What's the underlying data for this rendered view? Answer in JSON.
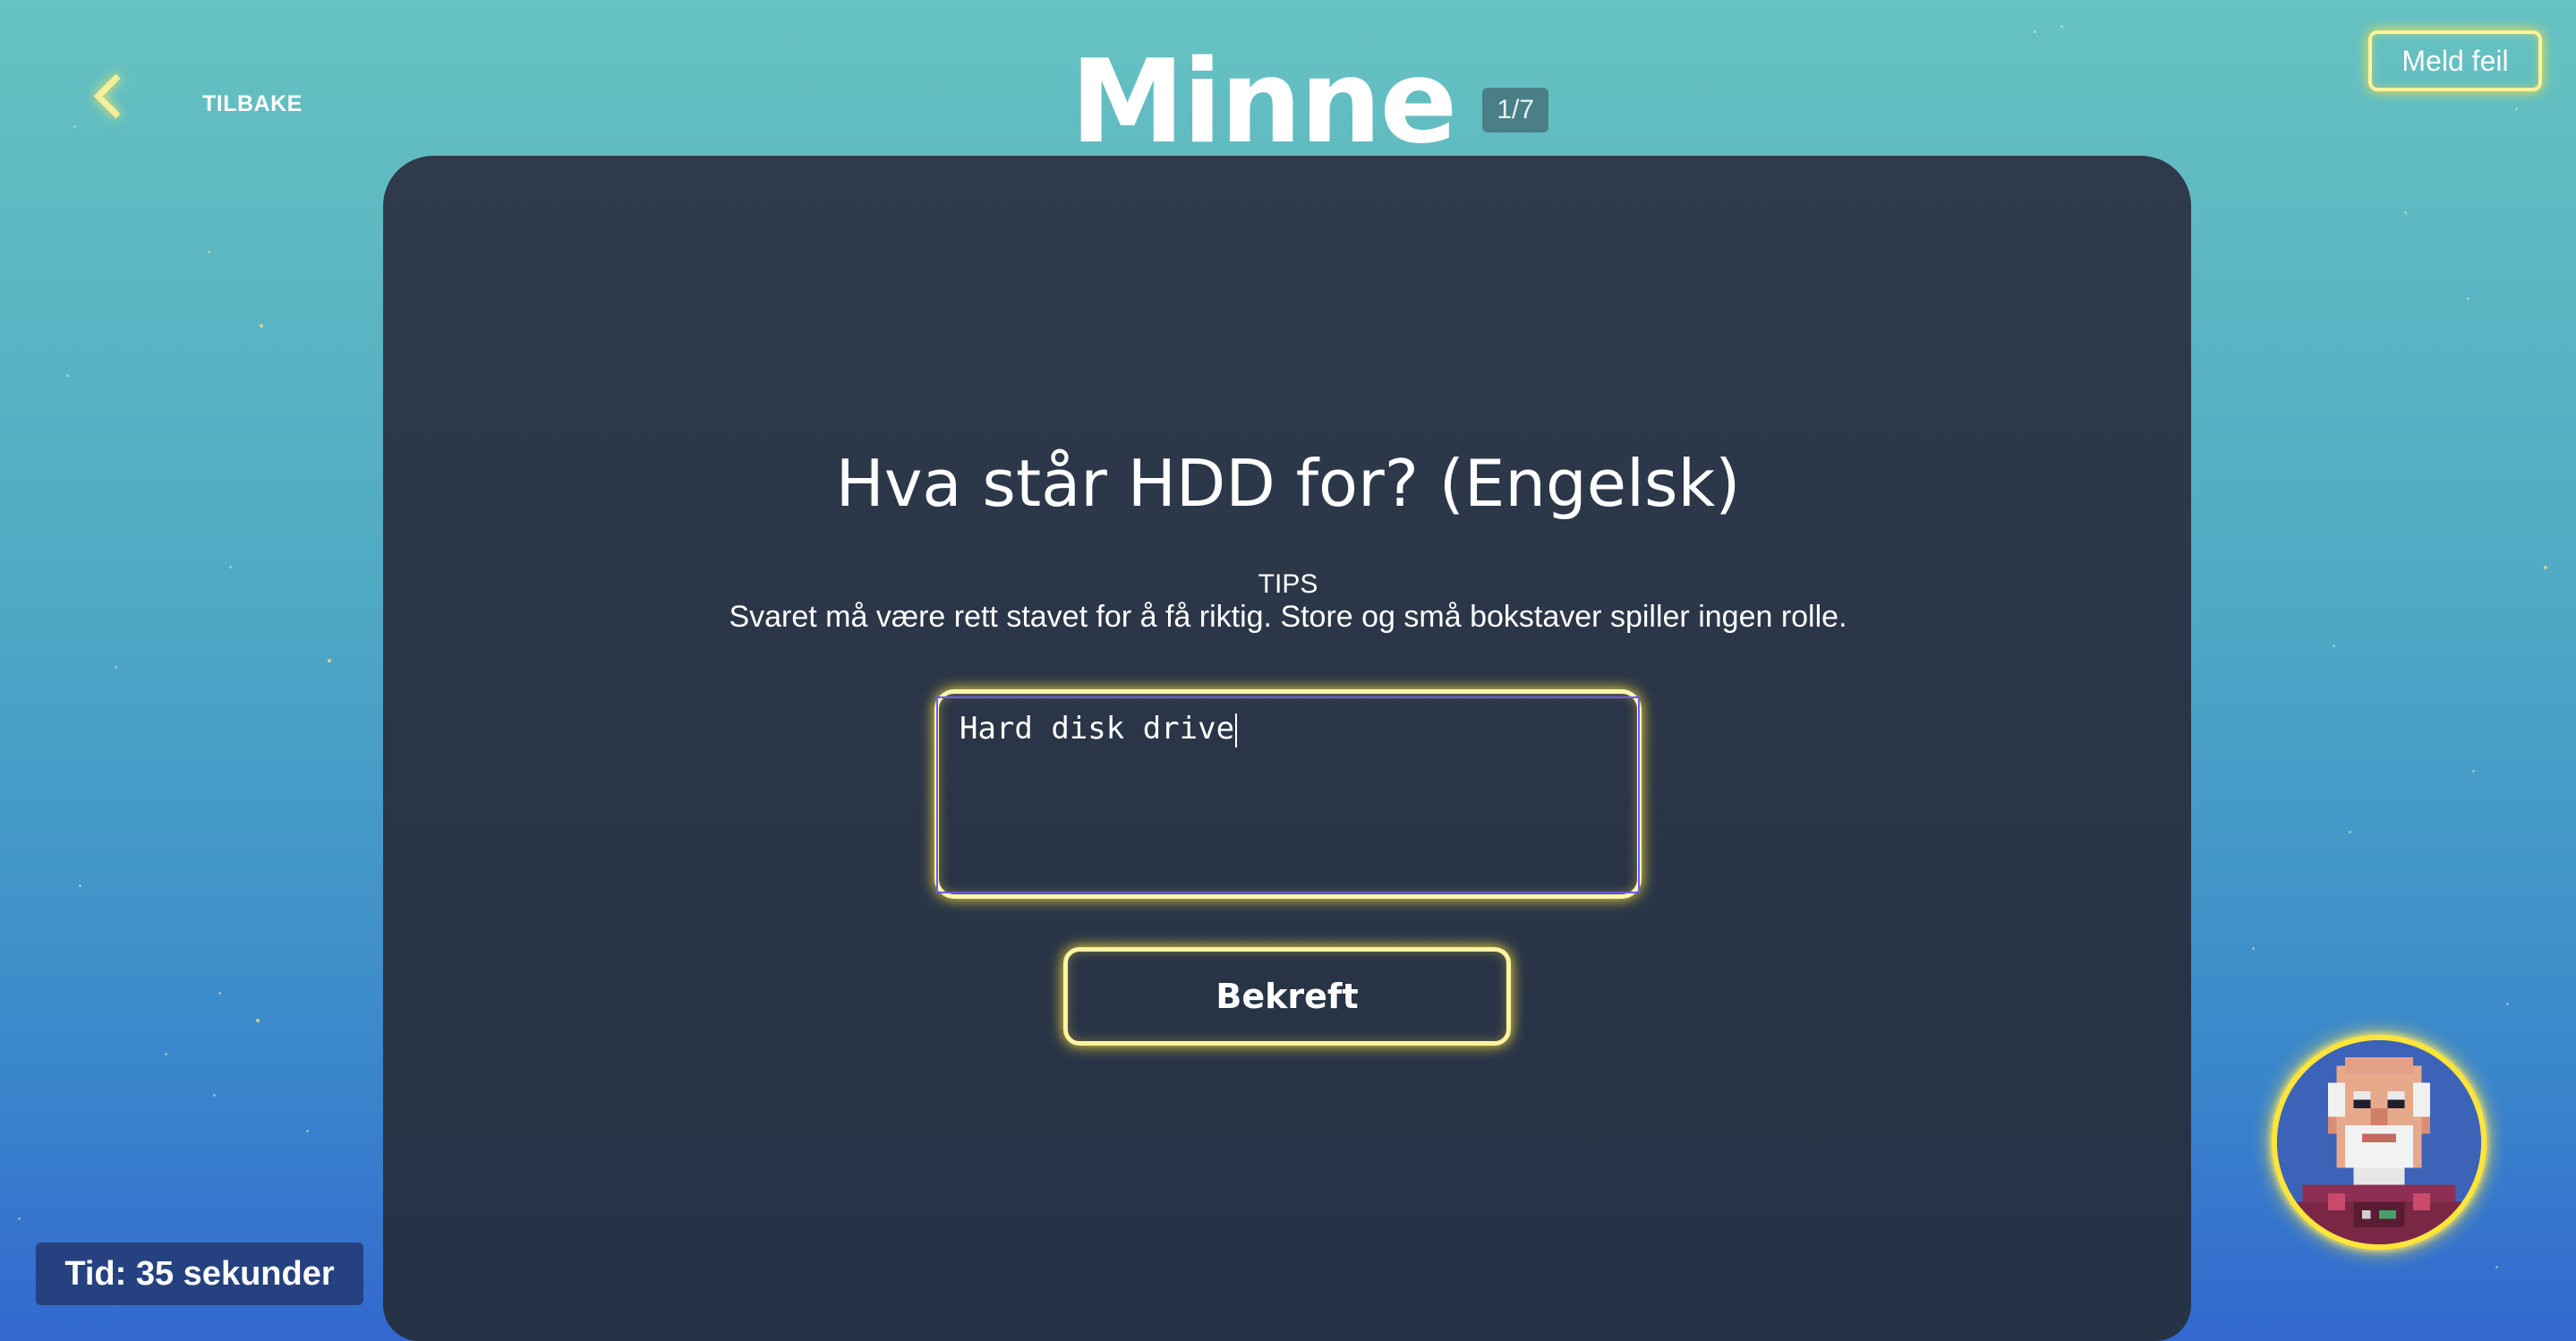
{
  "header": {
    "back_label": "TILBAKE",
    "title": "Minne",
    "progress": "1/7",
    "report_label": "Meld feil"
  },
  "quiz": {
    "question": "Hva står HDD for? (Engelsk)",
    "tips_heading": "TIPS",
    "tips_text": "Svaret må være rett stavet for å få riktig. Store og små bokstaver spiller ingen rolle.",
    "answer_value": "Hard disk drive",
    "confirm_label": "Bekreft"
  },
  "footer": {
    "timer": "Tid: 35 sekunder"
  },
  "avatar": {
    "icon": "pixel-astronaut-old-man-avatar"
  },
  "colors": {
    "accent_glow": "#ffe43a",
    "card_bg": "#2b3648",
    "timer_bg": "#25417f"
  }
}
